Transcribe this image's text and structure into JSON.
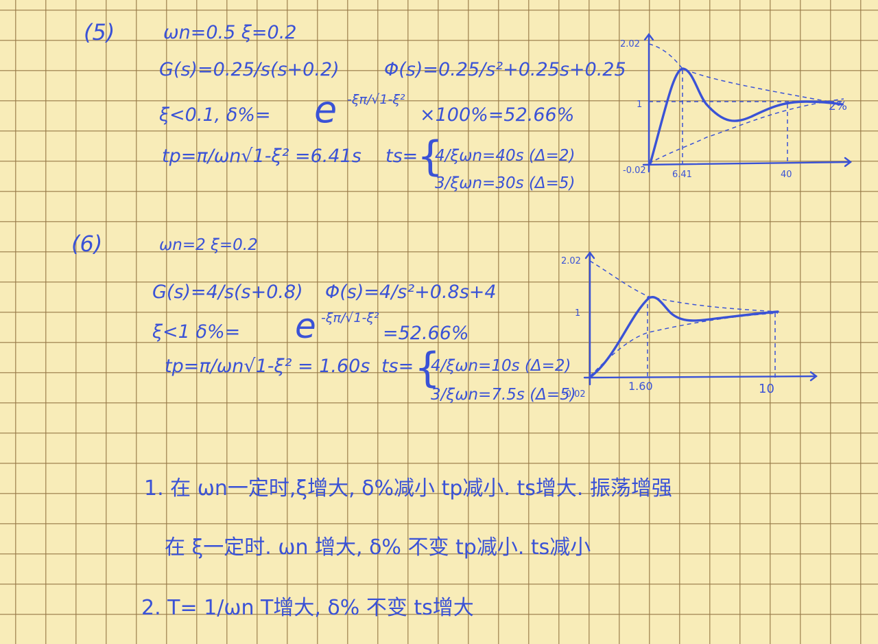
{
  "part5": {
    "label": "(5)",
    "params": "ωn=0.5   ξ=0.2",
    "open_loop": "G(s)=0.25/s(s+0.2)",
    "closed_loop": "Φ(s)=0.25/s²+0.25s+0.25",
    "overshoot_prefix": "ξ<0.1,  δ%=",
    "overshoot_exp": "-ξπ/√1-ξ²",
    "overshoot_value": "×100%=52.66%",
    "tp": "tp=π/ωn√1-ξ² =6.41s",
    "ts_label": "ts=",
    "ts_case1": "4/ξωn=40s (Δ=2)",
    "ts_case2": "3/ξωn=30s (Δ=5)",
    "graph": {
      "y_top": "2.02",
      "y_one": "1",
      "origin": "-0.02",
      "x_peak": "6.41",
      "x_ts": "40",
      "band": "2%"
    }
  },
  "part6": {
    "label": "(6)",
    "params": "ωn=2    ξ=0.2",
    "open_loop": "G(s)=4/s(s+0.8)",
    "closed_loop": "Φ(s)=4/s²+0.8s+4",
    "overshoot_prefix": "ξ<1     δ%=",
    "overshoot_exp": "-ξπ/√1-ξ²",
    "overshoot_value": "=52.66%",
    "tp": "tp=π/ωn√1-ξ² = 1.60s",
    "ts_label": "ts=",
    "ts_case1": "4/ξωn=10s (Δ=2)",
    "ts_case2": "3/ξωn=7.5s (Δ=5)",
    "graph": {
      "y_top": "2.02",
      "y_one": "1",
      "origin": "-0.02",
      "x_peak": "1.60",
      "x_ts": "10"
    }
  },
  "conclusions": {
    "line1": "1. 在 ωn一定时,ξ增大,  δ%减小  tp减小.  ts增大. 振荡增强",
    "line2": "在 ξ一定时. ωn 增大,  δ% 不变    tp减小. ts减小",
    "line3": "2. T= 1/ωn      T增大,   δ% 不变   ts增大"
  }
}
